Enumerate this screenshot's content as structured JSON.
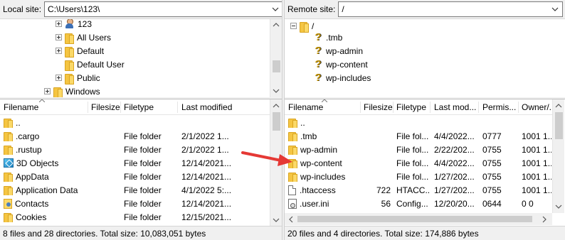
{
  "local": {
    "site_label": "Local site:",
    "path": "C:\\Users\\123\\",
    "tree": [
      {
        "label": "123",
        "icon": "user-icon",
        "expander": "plus"
      },
      {
        "label": "All Users",
        "icon": "folder-icon",
        "expander": "plus"
      },
      {
        "label": "Default",
        "icon": "folder-icon",
        "expander": "plus"
      },
      {
        "label": "Default User",
        "icon": "folder-icon",
        "expander": "none"
      },
      {
        "label": "Public",
        "icon": "folder-icon",
        "expander": "plus"
      },
      {
        "label": "Windows",
        "icon": "folder-icon",
        "expander": "plus"
      }
    ],
    "columns": [
      "Filename",
      "Filesize",
      "Filetype",
      "Last modified"
    ],
    "rows": [
      {
        "name": "..",
        "size": "",
        "type": "",
        "modified": "",
        "icon": "folder-icon"
      },
      {
        "name": ".cargo",
        "size": "",
        "type": "File folder",
        "modified": "2/1/2022 1...",
        "icon": "folder-icon"
      },
      {
        "name": ".rustup",
        "size": "",
        "type": "File folder",
        "modified": "2/1/2022 1...",
        "icon": "folder-icon"
      },
      {
        "name": "3D Objects",
        "size": "",
        "type": "File folder",
        "modified": "12/14/2021...",
        "icon": "3d-objects-icon"
      },
      {
        "name": "AppData",
        "size": "",
        "type": "File folder",
        "modified": "12/14/2021...",
        "icon": "folder-icon"
      },
      {
        "name": "Application Data",
        "size": "",
        "type": "File folder",
        "modified": "4/1/2022 5:...",
        "icon": "folder-icon"
      },
      {
        "name": "Contacts",
        "size": "",
        "type": "File folder",
        "modified": "12/14/2021...",
        "icon": "contacts-icon"
      },
      {
        "name": "Cookies",
        "size": "",
        "type": "File folder",
        "modified": "12/15/2021...",
        "icon": "folder-icon"
      }
    ],
    "status": "8 files and 28 directories. Total size: 10,083,051 bytes"
  },
  "remote": {
    "site_label": "Remote site:",
    "path": "/",
    "tree_root": "/",
    "tree": [
      {
        "label": ".tmb",
        "icon": "question-icon"
      },
      {
        "label": "wp-admin",
        "icon": "question-icon"
      },
      {
        "label": "wp-content",
        "icon": "question-icon"
      },
      {
        "label": "wp-includes",
        "icon": "question-icon"
      }
    ],
    "columns": [
      "Filename",
      "Filesize",
      "Filetype",
      "Last mod...",
      "Permis...",
      "Owner/..."
    ],
    "rows": [
      {
        "name": "..",
        "size": "",
        "type": "",
        "modified": "",
        "perms": "",
        "owner": "",
        "icon": "folder-icon"
      },
      {
        "name": ".tmb",
        "size": "",
        "type": "File fol...",
        "modified": "4/4/2022...",
        "perms": "0777",
        "owner": "1001 1...",
        "icon": "folder-icon"
      },
      {
        "name": "wp-admin",
        "size": "",
        "type": "File fol...",
        "modified": "2/22/202...",
        "perms": "0755",
        "owner": "1001 1...",
        "icon": "folder-icon"
      },
      {
        "name": "wp-content",
        "size": "",
        "type": "File fol...",
        "modified": "4/4/2022...",
        "perms": "0755",
        "owner": "1001 1...",
        "icon": "folder-icon"
      },
      {
        "name": "wp-includes",
        "size": "",
        "type": "File fol...",
        "modified": "1/27/202...",
        "perms": "0755",
        "owner": "1001 1...",
        "icon": "folder-icon"
      },
      {
        "name": ".htaccess",
        "size": "722",
        "type": "HTACC...",
        "modified": "1/27/202...",
        "perms": "0755",
        "owner": "1001 1...",
        "icon": "document-icon"
      },
      {
        "name": ".user.ini",
        "size": "56",
        "type": "Config...",
        "modified": "12/20/20...",
        "perms": "0644",
        "owner": "0 0",
        "icon": "config-file-icon"
      }
    ],
    "status": "20 files and 4 directories. Total size: 174,886 bytes"
  },
  "annotation": {
    "arrow_color": "#e53935"
  }
}
